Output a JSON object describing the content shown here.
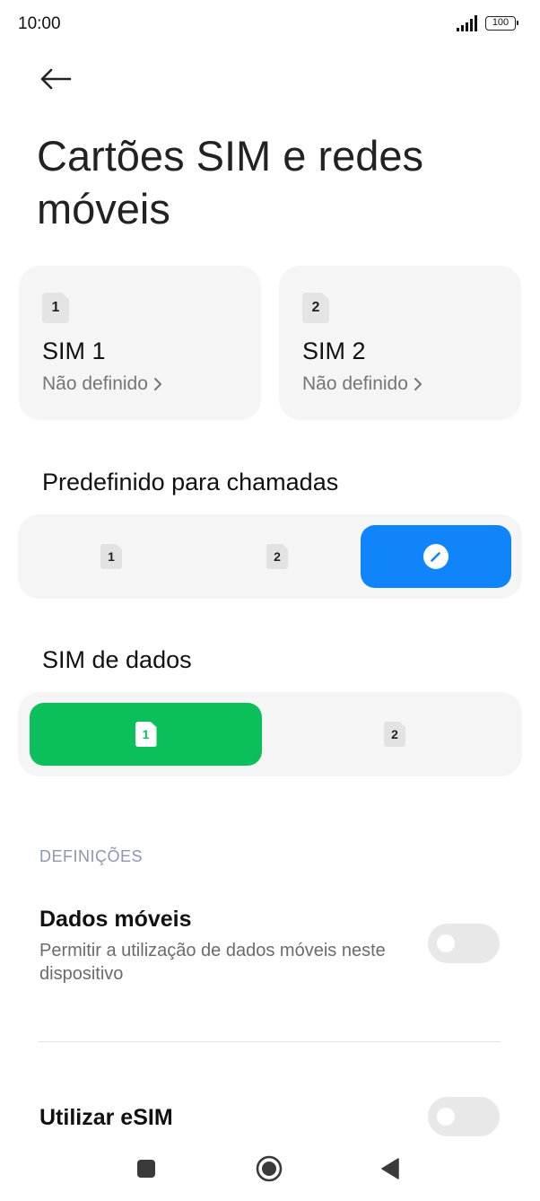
{
  "status_bar": {
    "time": "10:00",
    "battery": "100",
    "icons": [
      "signal-icon",
      "battery-icon"
    ]
  },
  "header": {
    "back_icon": "arrow-left-icon",
    "title": "Cartões SIM e redes móveis"
  },
  "sim_cards": [
    {
      "slot": "1",
      "name": "SIM 1",
      "status": "Não definido",
      "icon": "sim-card-icon"
    },
    {
      "slot": "2",
      "name": "SIM 2",
      "status": "Não definido",
      "icon": "sim-card-icon"
    }
  ],
  "calls": {
    "heading": "Predefinido para chamadas",
    "options": [
      {
        "label": "1",
        "icon": "sim-card-icon"
      },
      {
        "label": "2",
        "icon": "sim-card-icon"
      },
      {
        "label": "",
        "icon": "edit-icon"
      }
    ],
    "selected_index": 2
  },
  "data_sim": {
    "heading": "SIM de dados",
    "options": [
      {
        "label": "1",
        "icon": "sim-card-icon"
      },
      {
        "label": "2",
        "icon": "sim-card-icon"
      }
    ],
    "selected_index": 0
  },
  "settings": {
    "section_label": "DEFINIÇÕES",
    "mobile_data": {
      "title": "Dados móveis",
      "description": "Permitir a utilização de dados móveis neste dispositivo",
      "enabled": false
    },
    "esim": {
      "title": "Utilizar eSIM",
      "enabled": false
    }
  },
  "nav_bar": {
    "recents_icon": "square-icon",
    "home_icon": "circle-home-icon",
    "back_icon": "triangle-back-icon"
  },
  "colors": {
    "accent_blue": "#0f84fb",
    "accent_green": "#0bbf5a",
    "card_bg": "#f5f5f5",
    "section_label": "#8e95b0"
  }
}
